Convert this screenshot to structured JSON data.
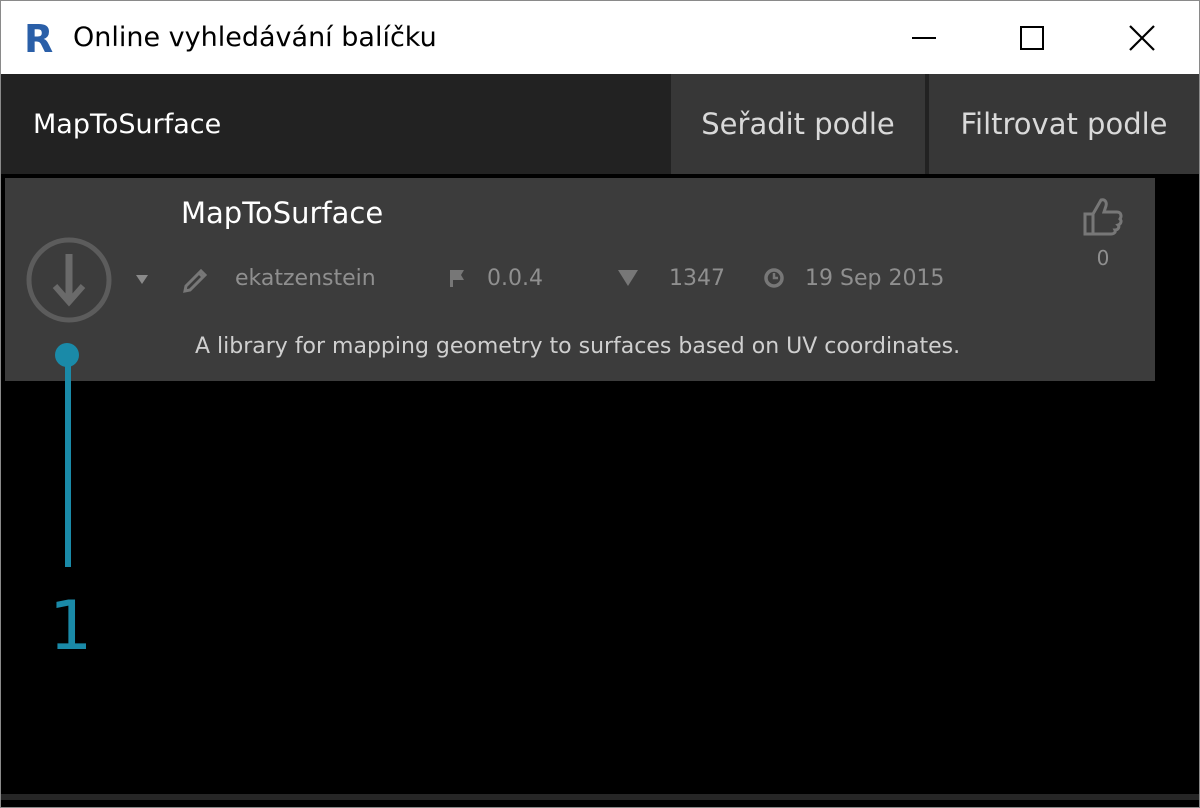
{
  "window": {
    "title": "Online vyhledávání balíčku",
    "app_icon_letter": "R",
    "controls": [
      "minimize-icon",
      "maximize-icon",
      "close-icon"
    ]
  },
  "toolbar": {
    "search_value": "MapToSurface",
    "sort_label": "Seřadit podle",
    "filter_label": "Filtrovat podle"
  },
  "package": {
    "name": "MapToSurface",
    "author": "ekatzenstein",
    "version": "0.0.4",
    "downloads": "1347",
    "date": "19 Sep 2015",
    "description": "A library for mapping geometry to surfaces based on UV coordinates.",
    "likes": "0"
  },
  "callout": {
    "number": "1",
    "color": "#1a8aa8"
  },
  "colors": {
    "titlebar_bg": "#ffffff",
    "toolbar_bg": "#222222",
    "button_bg": "#373737",
    "card_bg": "#3c3c3c",
    "app_icon": "#2a5fa8",
    "callout": "#1a8aa8"
  }
}
